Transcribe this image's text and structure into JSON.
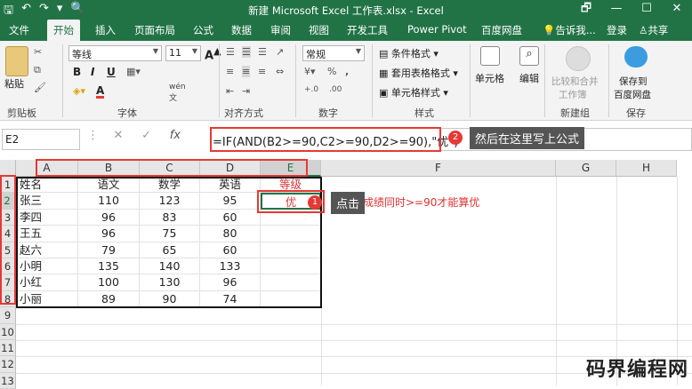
{
  "app": {
    "title": "新建 Microsoft Excel 工作表.xlsx - Excel",
    "window_buttons": [
      "🗗",
      "—",
      "☐",
      "✕"
    ]
  },
  "menu": {
    "tabs": [
      "文件",
      "开始",
      "插入",
      "页面布局",
      "公式",
      "数据",
      "审阅",
      "视图",
      "开发工具",
      "Power Pivot",
      "百度网盘"
    ],
    "tell_me": "告诉我...",
    "login": "登录",
    "share": "共享"
  },
  "ribbon": {
    "paste": "粘贴",
    "clipboard": "剪贴板",
    "font_name": "等线",
    "font_size": "11",
    "font_group": "字体",
    "align_group": "对齐方式",
    "number_format": "常规",
    "number_group": "数字",
    "cond_format": "条件格式",
    "table_format": "套用表格格式",
    "cell_styles": "单元格样式",
    "styles_group": "样式",
    "cells": "单元格",
    "editing": "编辑",
    "compare_merge_1": "比较和合并",
    "compare_merge_2": "工作簿",
    "new_group": "新建组",
    "save_to_1": "保存到",
    "save_to_2": "百度网盘",
    "save_group": "保存",
    "bold": "B",
    "italic": "I",
    "underline": "U",
    "font_color": "A",
    "wen": "wén",
    "wen2": "文",
    "percent": "%",
    "thousands": ",",
    "dec1": "+.0",
    "dec2": ".00"
  },
  "formula_bar": {
    "name_box": "E2",
    "fx": "fx",
    "formula": "=IF(AND(B2>=90,C2>=90,D2>=90),\"优\")"
  },
  "sheet": {
    "columns": [
      "A",
      "B",
      "C",
      "D",
      "E",
      "F",
      "G",
      "H"
    ],
    "rows": [
      "1",
      "2",
      "3",
      "4",
      "5",
      "6",
      "7",
      "8",
      "9",
      "10",
      "11",
      "12",
      "13"
    ],
    "header": [
      "姓名",
      "语文",
      "数学",
      "英语",
      "等级"
    ],
    "data": [
      [
        "张三",
        "110",
        "123",
        "95",
        "优"
      ],
      [
        "李四",
        "96",
        "83",
        "60",
        ""
      ],
      [
        "王五",
        "96",
        "75",
        "80",
        ""
      ],
      [
        "赵六",
        "79",
        "65",
        "60",
        ""
      ],
      [
        "小明",
        "135",
        "140",
        "133",
        ""
      ],
      [
        "小红",
        "100",
        "130",
        "96",
        ""
      ],
      [
        "小丽",
        "89",
        "90",
        "74",
        ""
      ]
    ]
  },
  "annotations": {
    "step1": "1",
    "step2": "2",
    "callout1": "点击",
    "callout2": "然后在这里写上公式",
    "note": "成绩同时>=90才能算优"
  },
  "watermark": "码界编程网"
}
